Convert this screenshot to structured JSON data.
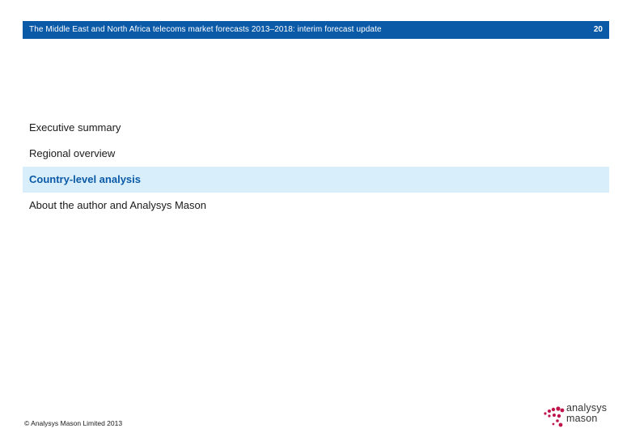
{
  "header": {
    "title": "The Middle East and North Africa telecoms market forecasts 2013–2018: interim forecast update",
    "page_number": "20"
  },
  "agenda": {
    "items": [
      {
        "label": "Executive summary",
        "active": false
      },
      {
        "label": "Regional overview",
        "active": false
      },
      {
        "label": "Country-level analysis",
        "active": true
      },
      {
        "label": "About the author and Analysys Mason",
        "active": false
      }
    ]
  },
  "footer": {
    "copyright": "© Analysys Mason Limited 2013",
    "logo": {
      "line1": "analysys",
      "line2": "mason",
      "icon": "analysys-mason-logo-icon"
    }
  },
  "colors": {
    "header_bg": "#0a5aa8",
    "active_item_bg": "#d9eefb",
    "active_item_text": "#0a5aa8",
    "logo_dots": "#c0154c"
  }
}
